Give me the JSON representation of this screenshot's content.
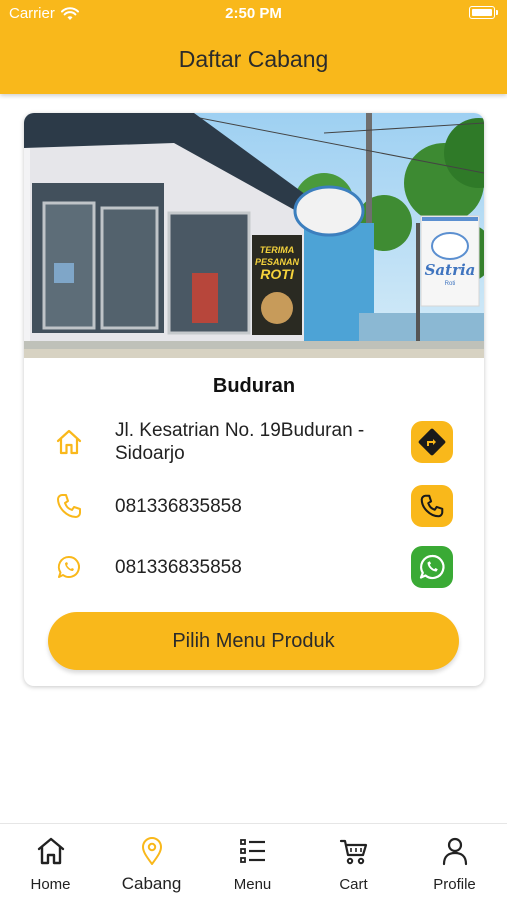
{
  "status_bar": {
    "carrier": "Carrier",
    "time": "2:50 PM"
  },
  "header": {
    "title": "Daftar Cabang"
  },
  "branch": {
    "name": "Buduran",
    "photo_signs": {
      "shop_name": "Satria",
      "shop_name_sub": "Roti",
      "banner_line1": "TERIMA",
      "banner_line2": "PESANAN",
      "banner_line3": "ROTI"
    },
    "address": "Jl. Kesatrian No. 19Buduran - Sidoarjo",
    "phone": "081336835858",
    "whatsapp": "081336835858",
    "button_label": "Pilih Menu Produk"
  },
  "tabs": [
    {
      "label": "Home",
      "icon": "home-icon",
      "active": false
    },
    {
      "label": "Cabang",
      "icon": "location-pin-icon",
      "active": true
    },
    {
      "label": "Menu",
      "icon": "list-icon",
      "active": false
    },
    {
      "label": "Cart",
      "icon": "cart-icon",
      "active": false
    },
    {
      "label": "Profile",
      "icon": "user-icon",
      "active": false
    }
  ],
  "colors": {
    "accent": "#f9b81b",
    "whatsapp": "#3aaa35",
    "active_tab": "#f9b81b"
  }
}
